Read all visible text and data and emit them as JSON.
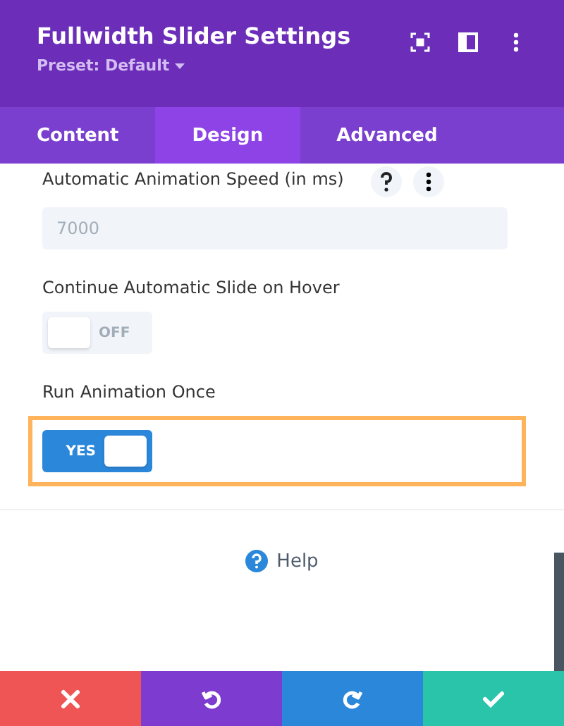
{
  "header": {
    "title": "Fullwidth Slider Settings",
    "preset": "Preset: Default"
  },
  "tabs": [
    {
      "label": "Content",
      "selected": false
    },
    {
      "label": "Design",
      "selected": true
    },
    {
      "label": "Advanced",
      "selected": false
    }
  ],
  "fields": [
    {
      "kind": "number",
      "label": "Automatic Animation Speed (in ms)",
      "placeholder": "7000",
      "highlighted": false
    },
    {
      "kind": "toggle",
      "label": "Continue Automatic Slide on Hover",
      "on": false,
      "state_text": "OFF",
      "highlighted": false
    },
    {
      "kind": "toggle",
      "label": "Run Animation Once",
      "on": true,
      "state_text": "YES",
      "highlighted": true
    }
  ],
  "help": "Help",
  "footer": [
    {
      "kind": "discard"
    },
    {
      "kind": "undo"
    },
    {
      "kind": "redo"
    },
    {
      "kind": "save"
    }
  ]
}
